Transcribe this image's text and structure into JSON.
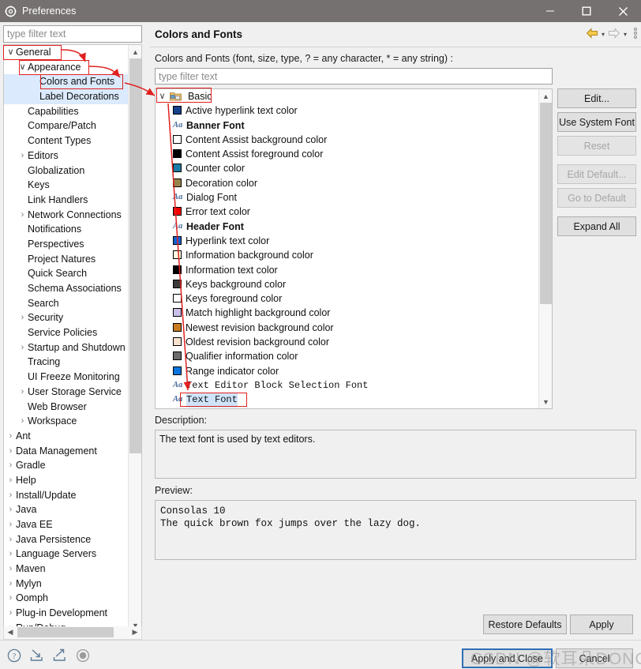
{
  "window": {
    "title": "Preferences",
    "app_icon": "gear-icon",
    "minimize_label": "—",
    "maximize_label": "☐",
    "close_label": "✕"
  },
  "left_pane": {
    "filter_placeholder": "type filter text",
    "tree": [
      {
        "label": "General",
        "indent": 0,
        "twisty": "down",
        "selected": false
      },
      {
        "label": "Appearance",
        "indent": 1,
        "twisty": "down",
        "selected": false
      },
      {
        "label": "Colors and Fonts",
        "indent": 2,
        "twisty": "none",
        "selected": true
      },
      {
        "label": "Label Decorations",
        "indent": 2,
        "twisty": "none",
        "selected": true
      },
      {
        "label": "Capabilities",
        "indent": 1,
        "twisty": "none",
        "selected": false
      },
      {
        "label": "Compare/Patch",
        "indent": 1,
        "twisty": "none",
        "selected": false
      },
      {
        "label": "Content Types",
        "indent": 1,
        "twisty": "none",
        "selected": false
      },
      {
        "label": "Editors",
        "indent": 1,
        "twisty": "right",
        "selected": false
      },
      {
        "label": "Globalization",
        "indent": 1,
        "twisty": "none",
        "selected": false
      },
      {
        "label": "Keys",
        "indent": 1,
        "twisty": "none",
        "selected": false
      },
      {
        "label": "Link Handlers",
        "indent": 1,
        "twisty": "none",
        "selected": false
      },
      {
        "label": "Network Connections",
        "indent": 1,
        "twisty": "right",
        "selected": false
      },
      {
        "label": "Notifications",
        "indent": 1,
        "twisty": "none",
        "selected": false
      },
      {
        "label": "Perspectives",
        "indent": 1,
        "twisty": "none",
        "selected": false
      },
      {
        "label": "Project Natures",
        "indent": 1,
        "twisty": "none",
        "selected": false
      },
      {
        "label": "Quick Search",
        "indent": 1,
        "twisty": "none",
        "selected": false
      },
      {
        "label": "Schema Associations",
        "indent": 1,
        "twisty": "none",
        "selected": false
      },
      {
        "label": "Search",
        "indent": 1,
        "twisty": "none",
        "selected": false
      },
      {
        "label": "Security",
        "indent": 1,
        "twisty": "right",
        "selected": false
      },
      {
        "label": "Service Policies",
        "indent": 1,
        "twisty": "none",
        "selected": false
      },
      {
        "label": "Startup and Shutdown",
        "indent": 1,
        "twisty": "right",
        "selected": false
      },
      {
        "label": "Tracing",
        "indent": 1,
        "twisty": "none",
        "selected": false
      },
      {
        "label": "UI Freeze Monitoring",
        "indent": 1,
        "twisty": "none",
        "selected": false
      },
      {
        "label": "User Storage Service",
        "indent": 1,
        "twisty": "right",
        "selected": false
      },
      {
        "label": "Web Browser",
        "indent": 1,
        "twisty": "none",
        "selected": false
      },
      {
        "label": "Workspace",
        "indent": 1,
        "twisty": "right",
        "selected": false
      },
      {
        "label": "Ant",
        "indent": 0,
        "twisty": "right",
        "selected": false
      },
      {
        "label": "Data Management",
        "indent": 0,
        "twisty": "right",
        "selected": false
      },
      {
        "label": "Gradle",
        "indent": 0,
        "twisty": "right",
        "selected": false
      },
      {
        "label": "Help",
        "indent": 0,
        "twisty": "right",
        "selected": false
      },
      {
        "label": "Install/Update",
        "indent": 0,
        "twisty": "right",
        "selected": false
      },
      {
        "label": "Java",
        "indent": 0,
        "twisty": "right",
        "selected": false
      },
      {
        "label": "Java EE",
        "indent": 0,
        "twisty": "right",
        "selected": false
      },
      {
        "label": "Java Persistence",
        "indent": 0,
        "twisty": "right",
        "selected": false
      },
      {
        "label": "Language Servers",
        "indent": 0,
        "twisty": "right",
        "selected": false
      },
      {
        "label": "Maven",
        "indent": 0,
        "twisty": "right",
        "selected": false
      },
      {
        "label": "Mylyn",
        "indent": 0,
        "twisty": "right",
        "selected": false
      },
      {
        "label": "Oomph",
        "indent": 0,
        "twisty": "right",
        "selected": false
      },
      {
        "label": "Plug-in Development",
        "indent": 0,
        "twisty": "right",
        "selected": false
      },
      {
        "label": "Run/Debug",
        "indent": 0,
        "twisty": "right",
        "selected": false
      }
    ]
  },
  "right_pane": {
    "page_title": "Colors and Fonts",
    "group_label": "Colors and Fonts (font, size, type, ? = any character, * = any string) :",
    "list_filter_placeholder": "type filter text",
    "nav": {
      "back_icon": "back-arrow-icon",
      "back_caret": "▾",
      "forward_icon": "forward-arrow-icon",
      "forward_caret": "▾",
      "menu_icon": "vertical-dots-icon"
    },
    "root_node": {
      "label": "Basic",
      "twisty": "∨",
      "icon": "folder-theme-icon"
    },
    "items": [
      {
        "label": "Active hyperlink text color",
        "kind": "color",
        "color": "#14418c"
      },
      {
        "label": "Banner Font",
        "kind": "font",
        "bold": true,
        "mono": false
      },
      {
        "label": "Content Assist background color",
        "kind": "color",
        "color": "#ffffff"
      },
      {
        "label": "Content Assist foreground color",
        "kind": "color",
        "color": "#000000"
      },
      {
        "label": "Counter color",
        "kind": "color",
        "color": "#1a7ba5"
      },
      {
        "label": "Decoration color",
        "kind": "color",
        "color": "#97824e"
      },
      {
        "label": "Dialog Font",
        "kind": "font",
        "bold": false,
        "mono": false
      },
      {
        "label": "Error text color",
        "kind": "color",
        "color": "#f40000"
      },
      {
        "label": "Header Font",
        "kind": "font",
        "bold": true,
        "mono": false
      },
      {
        "label": "Hyperlink text color",
        "kind": "color",
        "color": "#0f62d4"
      },
      {
        "label": "Information background color",
        "kind": "color",
        "color": "#fbfbe0"
      },
      {
        "label": "Information text color",
        "kind": "color",
        "color": "#000000"
      },
      {
        "label": "Keys background color",
        "kind": "color",
        "color": "#3b3b3b"
      },
      {
        "label": "Keys foreground color",
        "kind": "color",
        "color": "#ffffff"
      },
      {
        "label": "Match highlight background color",
        "kind": "color",
        "color": "#c9bfe8"
      },
      {
        "label": "Newest revision background color",
        "kind": "color",
        "color": "#c97b22"
      },
      {
        "label": "Oldest revision background color",
        "kind": "color",
        "color": "#f7e0cd"
      },
      {
        "label": "Qualifier information color",
        "kind": "color",
        "color": "#6b6b6b"
      },
      {
        "label": "Range indicator color",
        "kind": "color",
        "color": "#0a74dd"
      },
      {
        "label": "Text Editor Block Selection Font",
        "kind": "font",
        "bold": false,
        "mono": true
      },
      {
        "label": "Text Font",
        "kind": "font",
        "bold": false,
        "mono": true,
        "selected": true
      }
    ],
    "side_buttons": [
      {
        "label": "Edit...",
        "enabled": true,
        "gap": false
      },
      {
        "label": "Use System Font",
        "enabled": true,
        "gap": false
      },
      {
        "label": "Reset",
        "enabled": false,
        "gap": false
      },
      {
        "label": "Edit Default...",
        "enabled": false,
        "gap": true
      },
      {
        "label": "Go to Default",
        "enabled": false,
        "gap": false
      },
      {
        "label": "Expand All",
        "enabled": true,
        "gap": true
      }
    ],
    "description_label": "Description:",
    "description_text": "The text font is used by text editors.",
    "preview_label": "Preview:",
    "preview_text": "Consolas 10\nThe quick brown fox jumps over the lazy dog."
  },
  "footer": {
    "restore_defaults": "Restore Defaults",
    "apply": "Apply",
    "apply_and_close": "Apply and Close",
    "cancel": "Cancel",
    "corner_icons": [
      "help-icon",
      "import-icon",
      "export-icon",
      "record-icon"
    ],
    "watermark": "CSDN @软耳朵DONG"
  },
  "colors": {
    "titlebar_bg": "#767171",
    "dialog_bg": "#f0f0f0",
    "selection_blue": "#dbeafc",
    "annotation_red": "#e02020",
    "focus_blue": "#2f6fb5"
  }
}
